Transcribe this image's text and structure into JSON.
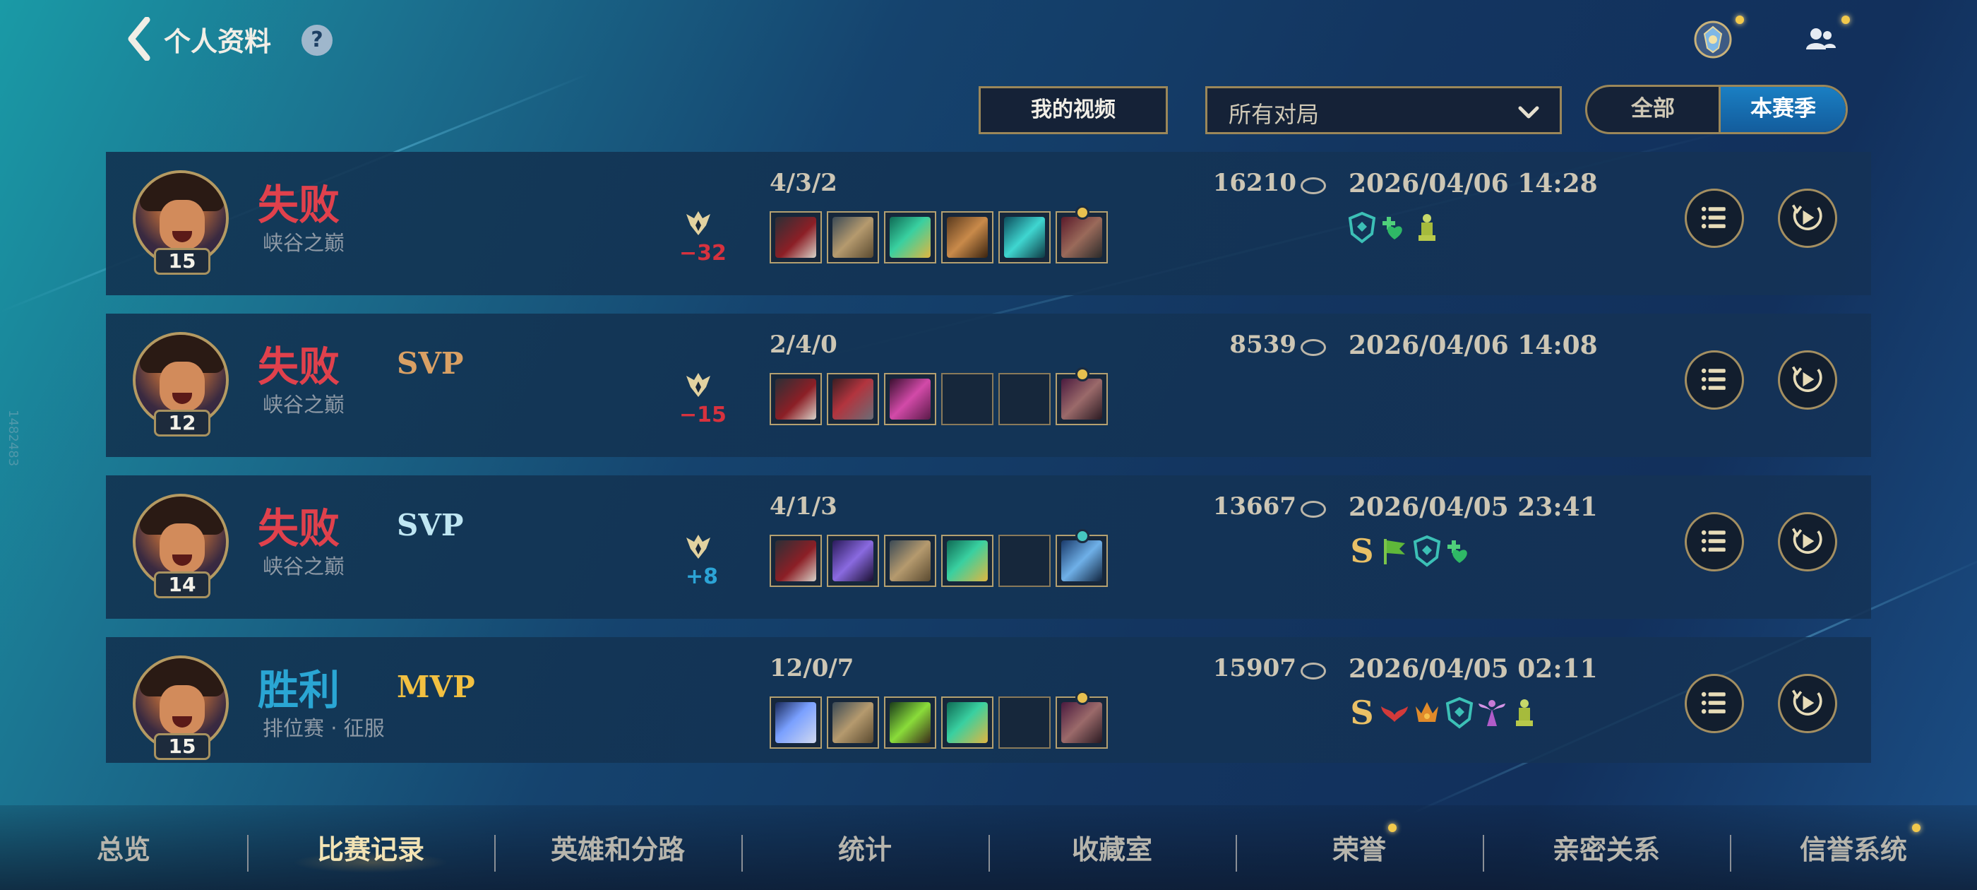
{
  "header": {
    "title": "个人资料",
    "help_glyph": "?"
  },
  "filters": {
    "video_button": "我的视频",
    "match_type": "所有对局",
    "scope_options": [
      "全部",
      "本赛季"
    ],
    "scope_selected": "本赛季"
  },
  "matches": [
    {
      "level": "15",
      "result": "失败",
      "result_type": "lose",
      "tag": "",
      "mode": "峡谷之巅",
      "rank_delta": "−32",
      "kda": "4/3/2",
      "gold": "16210",
      "datetime": "2026/04/06 14:28",
      "items": [
        "red-blade",
        "tan-axe",
        "green-staff",
        "bronze-armor",
        "teal-cloak",
        "red-hammer"
      ],
      "badges": [
        "shield-badge",
        "heal-badge",
        "tower-badge"
      ]
    },
    {
      "level": "12",
      "result": "失败",
      "result_type": "lose",
      "tag": "SVP",
      "tag_style": "svp-gold",
      "mode": "峡谷之巅",
      "rank_delta": "−15",
      "kda": "2/4/0",
      "gold": "8539",
      "datetime": "2026/04/06 14:08",
      "items": [
        "red-blade",
        "red-helm",
        "pink-gauntlet",
        "",
        "",
        "boots"
      ],
      "badges": []
    },
    {
      "level": "14",
      "result": "失败",
      "result_type": "lose",
      "tag": "SVP",
      "tag_style": "svp-blue",
      "mode": "峡谷之巅",
      "rank_delta": "+8",
      "kda": "4/1/3",
      "gold": "13667",
      "datetime": "2026/04/05 23:41",
      "items": [
        "red-blade",
        "purple-spear",
        "tan-axe",
        "green-staff",
        "",
        "blue-boots"
      ],
      "badges": [
        "S",
        "flag-badge",
        "shield-badge",
        "heal-badge"
      ]
    },
    {
      "level": "15",
      "result": "胜利",
      "result_type": "win",
      "tag": "MVP",
      "tag_style": "mvp",
      "mode": "排位赛 · 征服",
      "rank_delta": "",
      "kda": "12/0/7",
      "gold": "15907",
      "datetime": "2026/04/05 02:11",
      "items": [
        "blue-blade",
        "tan-axe",
        "green-skull",
        "green-staff",
        "",
        "boots"
      ],
      "badges": [
        "S",
        "wings-badge",
        "crown-badge",
        "shield-badge",
        "angel-badge",
        "tower-badge"
      ]
    }
  ],
  "bottom_nav": [
    "总览",
    "比赛记录",
    "英雄和分路",
    "统计",
    "收藏室",
    "荣誉",
    "亲密关系",
    "信誉系统"
  ],
  "bottom_nav_active": "比赛记录",
  "side_id": "1482483",
  "colors": {
    "accent_gold": "#9b8759",
    "lose": "#e0414c",
    "win": "#2aa6d4",
    "active_segment": "#1a7fc3"
  }
}
